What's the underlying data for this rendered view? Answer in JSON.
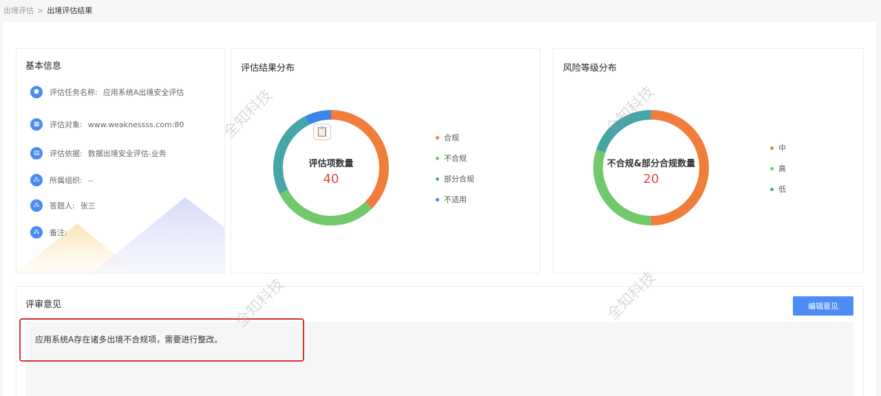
{
  "breadcrumb": {
    "parent": "出境评估",
    "separator": ">",
    "current": "出境评估结果"
  },
  "basic_info": {
    "title": "基本信息",
    "rows": [
      {
        "icon": "cube-icon",
        "label": "评估任务名称:",
        "value": "应用系统A出境安全评估"
      },
      {
        "icon": "grid-icon",
        "label": "评估对象:",
        "value": "www.weaknessss.com:80"
      },
      {
        "icon": "document-icon",
        "label": "评估依据:",
        "value": "数据出境安全评估-业务"
      },
      {
        "icon": "org-icon",
        "label": "所属组织:",
        "value": "--"
      },
      {
        "icon": "org-icon",
        "label": "答题人:",
        "value": "张三"
      },
      {
        "icon": "org-icon",
        "label": "备注:",
        "value": ""
      }
    ]
  },
  "result_distribution": {
    "title": "评估结果分布",
    "center_title": "评估项数量",
    "center_value": "40",
    "legend": [
      {
        "name": "合规",
        "color": "#f07d3c"
      },
      {
        "name": "不合规",
        "color": "#72c96b"
      },
      {
        "name": "部分合规",
        "color": "#45a6a8"
      },
      {
        "name": "不适用",
        "color": "#3b86e8"
      }
    ]
  },
  "risk_distribution": {
    "title": "风险等级分布",
    "center_title": "不合规&部分合规数量",
    "center_value": "20",
    "legend": [
      {
        "name": "中",
        "color": "#f07d3c"
      },
      {
        "name": "高",
        "color": "#72c96b"
      },
      {
        "name": "低",
        "color": "#45a6a8"
      }
    ]
  },
  "chart_data": [
    {
      "type": "pie",
      "title": "评估结果分布",
      "categories": [
        "合规",
        "不合规",
        "部分合规",
        "不适用"
      ],
      "values": [
        15,
        12,
        10,
        3
      ],
      "colors": [
        "#f07d3c",
        "#72c96b",
        "#45a6a8",
        "#3b86e8"
      ]
    },
    {
      "type": "pie",
      "title": "风险等级分布",
      "categories": [
        "中",
        "高",
        "低"
      ],
      "values": [
        10,
        6,
        4
      ],
      "colors": [
        "#f07d3c",
        "#72c96b",
        "#45a6a8"
      ]
    }
  ],
  "review": {
    "title": "评审意见",
    "edit_button": "编辑意见",
    "text": "应用系统A存在诸多出境不合规项，需要进行整改。"
  },
  "watermark": "全知科技"
}
